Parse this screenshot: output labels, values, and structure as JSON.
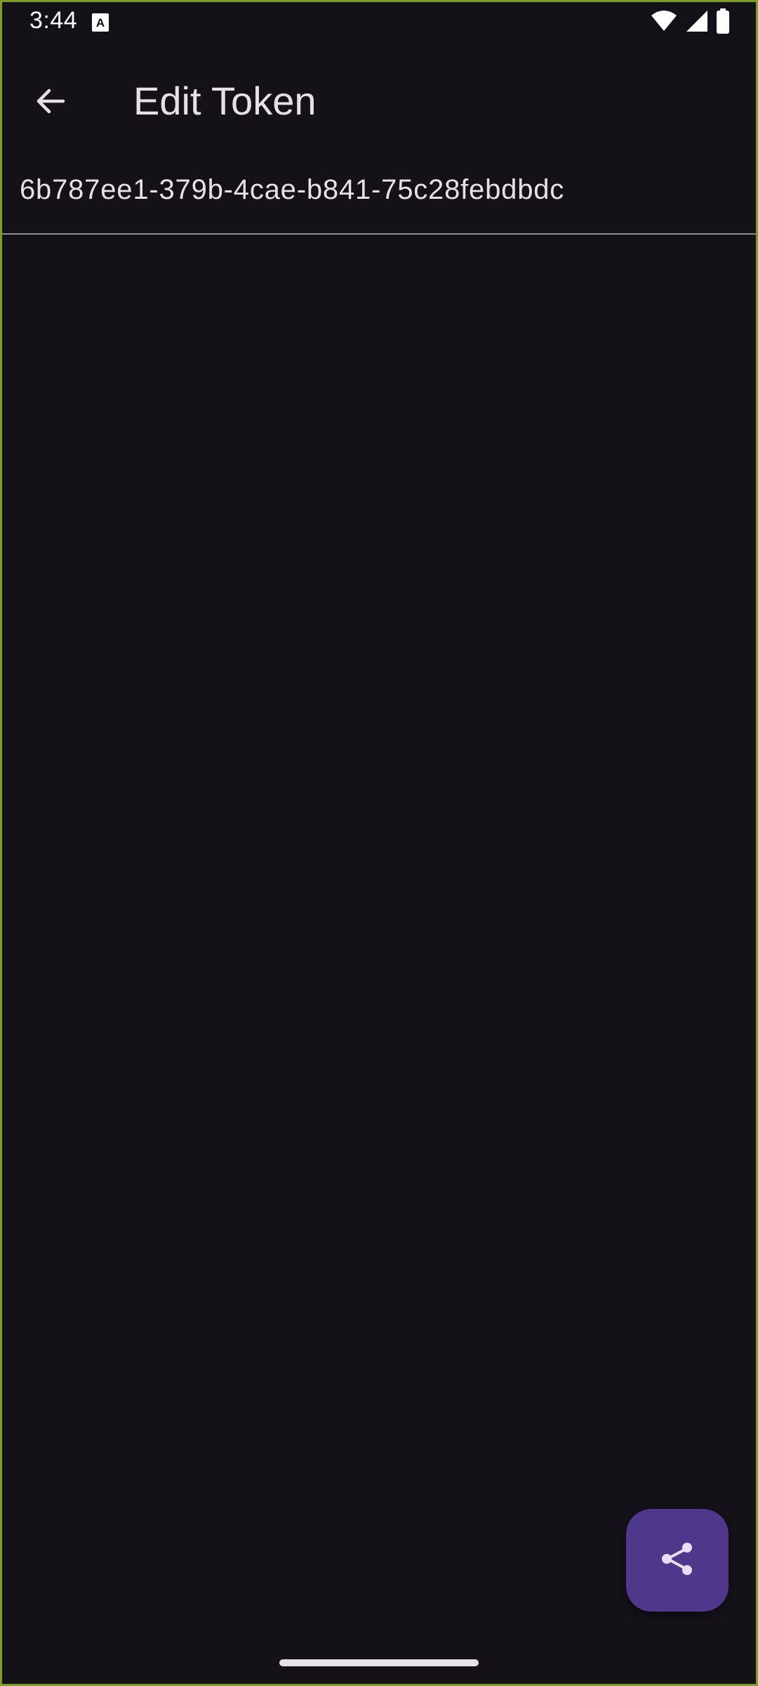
{
  "status_bar": {
    "time": "3:44",
    "notification_icon": "text-a-icon",
    "icons": [
      "wifi-icon",
      "cell-signal-icon",
      "battery-icon"
    ]
  },
  "app_bar": {
    "title": "Edit Token",
    "back_icon": "arrow-back-icon"
  },
  "token_field": {
    "value": "6b787ee1-379b-4cae-b841-75c28febdbdc"
  },
  "fab": {
    "icon": "share-icon"
  },
  "colors": {
    "background": "#141218",
    "on_surface": "#E6E0E9",
    "fab_container": "#4F378B",
    "fab_icon": "#E8DEF8",
    "underline": "#938F99",
    "frame_border": "#7CA01E"
  }
}
